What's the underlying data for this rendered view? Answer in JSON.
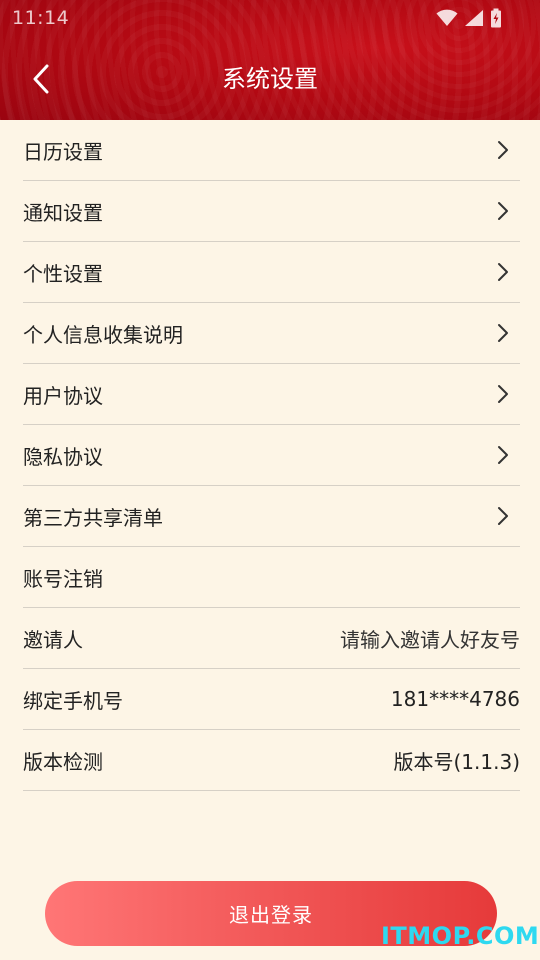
{
  "status_bar": {
    "time": "11:14",
    "icons": [
      "wifi-icon",
      "cell-signal-icon",
      "battery-charging-icon"
    ]
  },
  "header": {
    "title": "系统设置",
    "back_icon": "chevron-left-icon"
  },
  "settings": {
    "items": [
      {
        "label": "日历设置",
        "value": "",
        "chevron": true
      },
      {
        "label": "通知设置",
        "value": "",
        "chevron": true
      },
      {
        "label": "个性设置",
        "value": "",
        "chevron": true
      },
      {
        "label": "个人信息收集说明",
        "value": "",
        "chevron": true
      },
      {
        "label": "用户协议",
        "value": "",
        "chevron": true
      },
      {
        "label": "隐私协议",
        "value": "",
        "chevron": true
      },
      {
        "label": "第三方共享清单",
        "value": "",
        "chevron": true
      },
      {
        "label": "账号注销",
        "value": "",
        "chevron": false
      },
      {
        "label": "邀请人",
        "value": "请输入邀请人好友号",
        "chevron": false
      },
      {
        "label": "绑定手机号",
        "value": "181****4786",
        "chevron": false
      },
      {
        "label": "版本检测",
        "value": "版本号(1.1.3)",
        "chevron": false
      }
    ]
  },
  "logout": {
    "label": "退出登录"
  },
  "watermark": {
    "text": "ITMOP.COM"
  },
  "colors": {
    "header_red": "#B00812",
    "background": "#FDF5E6",
    "logout_gradient_start": "#FF7676",
    "logout_gradient_end": "#E63A3A",
    "watermark": "#2ED9F0"
  }
}
